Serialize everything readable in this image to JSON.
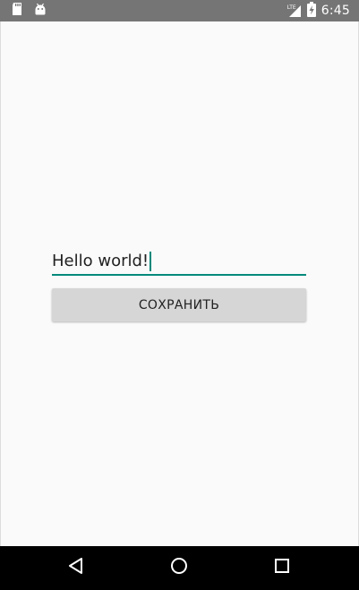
{
  "status_bar": {
    "time": "6:45",
    "network_label": "LTE",
    "icons": [
      "sd-card-icon",
      "android-icon",
      "signal-icon",
      "battery-charging-icon"
    ],
    "background_color": "#757575"
  },
  "form": {
    "input_value": "Hello world!",
    "accent_color": "#00897b",
    "save_button_label": "СОХРАНИТЬ"
  },
  "nav_bar": {
    "icons": [
      "back-icon",
      "home-icon",
      "recents-icon"
    ]
  }
}
